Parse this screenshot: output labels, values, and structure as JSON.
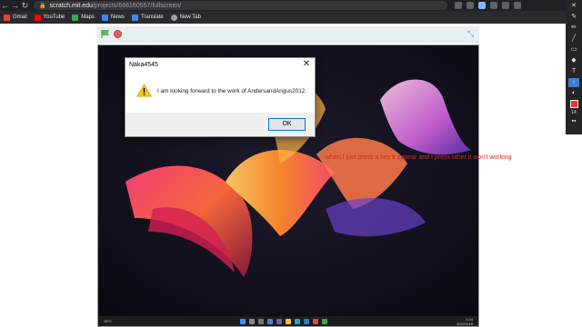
{
  "browser": {
    "url_host": "scratch.mit.edu",
    "url_path": "/projects/666160557/fullscreen/"
  },
  "bookmarks": [
    {
      "label": "Gmail",
      "icon": "gmail-icon",
      "color": "#ea4335"
    },
    {
      "label": "YouTube",
      "icon": "youtube-icon",
      "color": "#ff0000"
    },
    {
      "label": "Maps",
      "icon": "maps-icon",
      "color": "#34a853"
    },
    {
      "label": "News",
      "icon": "news-icon",
      "color": "#4285f4"
    },
    {
      "label": "Translate",
      "icon": "translate-icon",
      "color": "#4285f4"
    },
    {
      "label": "New Tab",
      "icon": "globe-icon",
      "color": "#9aa0a6"
    }
  ],
  "dialog": {
    "title": "Naka4545",
    "message": "I am looking forward to the work of AndersandAngus2012.",
    "ok_label": "OK",
    "close_glyph": "✕"
  },
  "comment": {
    "text": "when I just press a key it appear and I press other it won't working",
    "color": "#d32b1f"
  },
  "taskbar": {
    "weather": "18°C",
    "time": "1:24",
    "date": "2022/4/18"
  },
  "draw_tools": {
    "width_value": "14",
    "active_color": "#e53935"
  }
}
